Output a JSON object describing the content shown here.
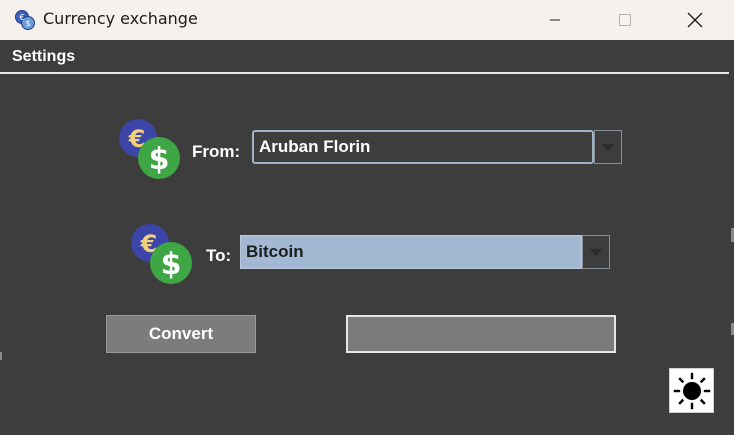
{
  "window": {
    "title": "Currency exchange",
    "controls": [
      "minimize",
      "maximize",
      "close"
    ]
  },
  "menu": {
    "items": [
      "Settings"
    ]
  },
  "form": {
    "from": {
      "label": "From:",
      "selected": "Aruban Florin"
    },
    "to": {
      "label": "To:",
      "selected": "Bitcoin"
    },
    "convert_label": "Convert",
    "result_value": ""
  },
  "icons": {
    "app": "currency-exchange-icon",
    "coins": "euro-dollar-coins-icon",
    "dropdown": "chevron-down-icon",
    "theme": "sun-icon"
  },
  "colors": {
    "background": "#3d3d3d",
    "titlebar": "#f7f1ee",
    "euro_coin": "#3b46a8",
    "dollar_coin": "#3fa645",
    "selected_field": "#a3b8d2"
  }
}
